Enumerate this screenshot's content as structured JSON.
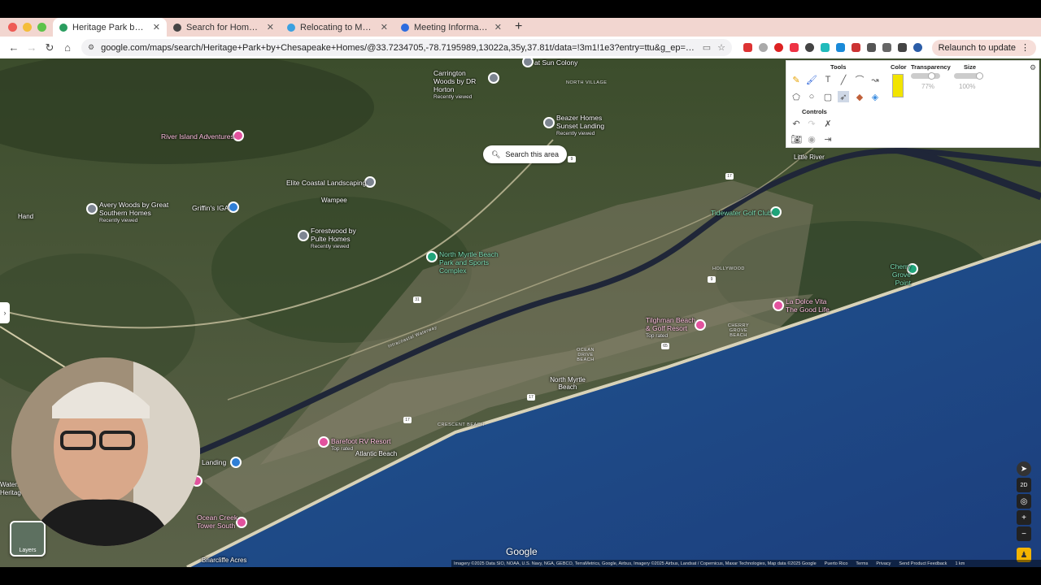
{
  "browser": {
    "tabs": [
      {
        "title": "Heritage Park by Chesapeake",
        "active": true,
        "favicon_color": "#2a9d5f"
      },
      {
        "title": "Search for Homes | RealScout",
        "active": false,
        "favicon_color": "#444"
      },
      {
        "title": "Relocating to Myrtle Beach S",
        "active": false,
        "favicon_color": "#3aa0e0"
      },
      {
        "title": "Meeting Information - Zoom",
        "active": false,
        "favicon_color": "#2d6cdf"
      }
    ],
    "url": "google.com/maps/search/Heritage+Park+by+Chesapeake+Homes/@33.7234705,-78.7195989,13022a,35y,37.81t/data=!3m1!1e3?entry=ttu&g_ep=EgoyMDI1MDMwMi4wIKXMDSoASAFQAw%3D...",
    "relaunch_label": "Relaunch to update"
  },
  "map": {
    "search_area_label": "Search this area",
    "pois": [
      {
        "name": "at Sun Colony",
        "sub": "",
        "color": "grey"
      },
      {
        "name": "Carrington Woods by DR Horton",
        "sub": "Recently viewed",
        "color": "grey"
      },
      {
        "name": "Beazer Homes Sunset Landing",
        "sub": "Recently viewed",
        "color": "grey"
      },
      {
        "name": "River Island Adventures",
        "sub": "",
        "color": "pink"
      },
      {
        "name": "Elite Coastal Landscaping",
        "sub": "",
        "color": "grey"
      },
      {
        "name": "Avery Woods by Great Southern Homes",
        "sub": "Recently viewed",
        "color": "grey"
      },
      {
        "name": "Griffin's IGA",
        "sub": "",
        "color": "blue"
      },
      {
        "name": "Forestwood by Pulte Homes",
        "sub": "Recently viewed",
        "color": "grey"
      },
      {
        "name": "North Myrtle Beach Park and Sports Complex",
        "sub": "",
        "color": "green"
      },
      {
        "name": "Tidewater Golf Club",
        "sub": "",
        "color": "green"
      },
      {
        "name": "Cherry Grove Point",
        "sub": "",
        "color": "green"
      },
      {
        "name": "La Dolce Vita The Good Life",
        "sub": "",
        "color": "pink"
      },
      {
        "name": "Tilghman Beach & Golf Resort",
        "sub": "Top rated",
        "color": "pink"
      },
      {
        "name": "Barefoot RV Resort",
        "sub": "Top rated",
        "color": "pink"
      },
      {
        "name": "Ocean Creek Tower South",
        "sub": "",
        "color": "pink"
      },
      {
        "name": "Landing",
        "sub": "",
        "color": "blue"
      }
    ],
    "places": {
      "wampee": "Wampee",
      "hand": "Hand",
      "little_river": "Little River",
      "north_myrtle_beach": "North Myrtle Beach",
      "atlantic_beach": "Atlantic Beach",
      "briarcliffe": "Briarcliffe Acres",
      "heritage": "Heritage",
      "waters": "Waters"
    },
    "tiny_labels": {
      "north_village": "NORTH VILLAGE",
      "hollywood": "HOLLYWOOD",
      "cherry_grove_beach": "CHERRY GROVE BEACH",
      "ocean_drive_beach": "OCEAN DRIVE BEACH",
      "crescent_beach": "CRESCENT BEACH",
      "waterway": "Intracoastal Waterway"
    },
    "route_shields": [
      "9",
      "17",
      "31",
      "65",
      "17",
      "9",
      "17"
    ],
    "layers_label": "Layers",
    "google_logo": "Google",
    "attribution": "Imagery ©2025 Data SIO, NOAA, U.S. Navy, NGA, GEBCO, TerraMetrics, Google, Airbus, Imagery ©2025 Airbus, Landsat / Copernicus, Maxar Technologies, Map data ©2025 Google",
    "attribution_links": [
      "Puerto Rico",
      "Terms",
      "Privacy",
      "Send Product Feedback"
    ],
    "scale_label": "1 km",
    "controls": {
      "view_2d": "2D"
    }
  },
  "annotation_tool": {
    "tools_header": "Tools",
    "color_header": "Color",
    "transparency_header": "Transparency",
    "size_header": "Size",
    "controls_header": "Controls",
    "transparency_value": "77%",
    "size_value": "100%",
    "transparency_fraction": 0.77,
    "size_fraction": 1.0,
    "selected_color": "#f2e400"
  }
}
